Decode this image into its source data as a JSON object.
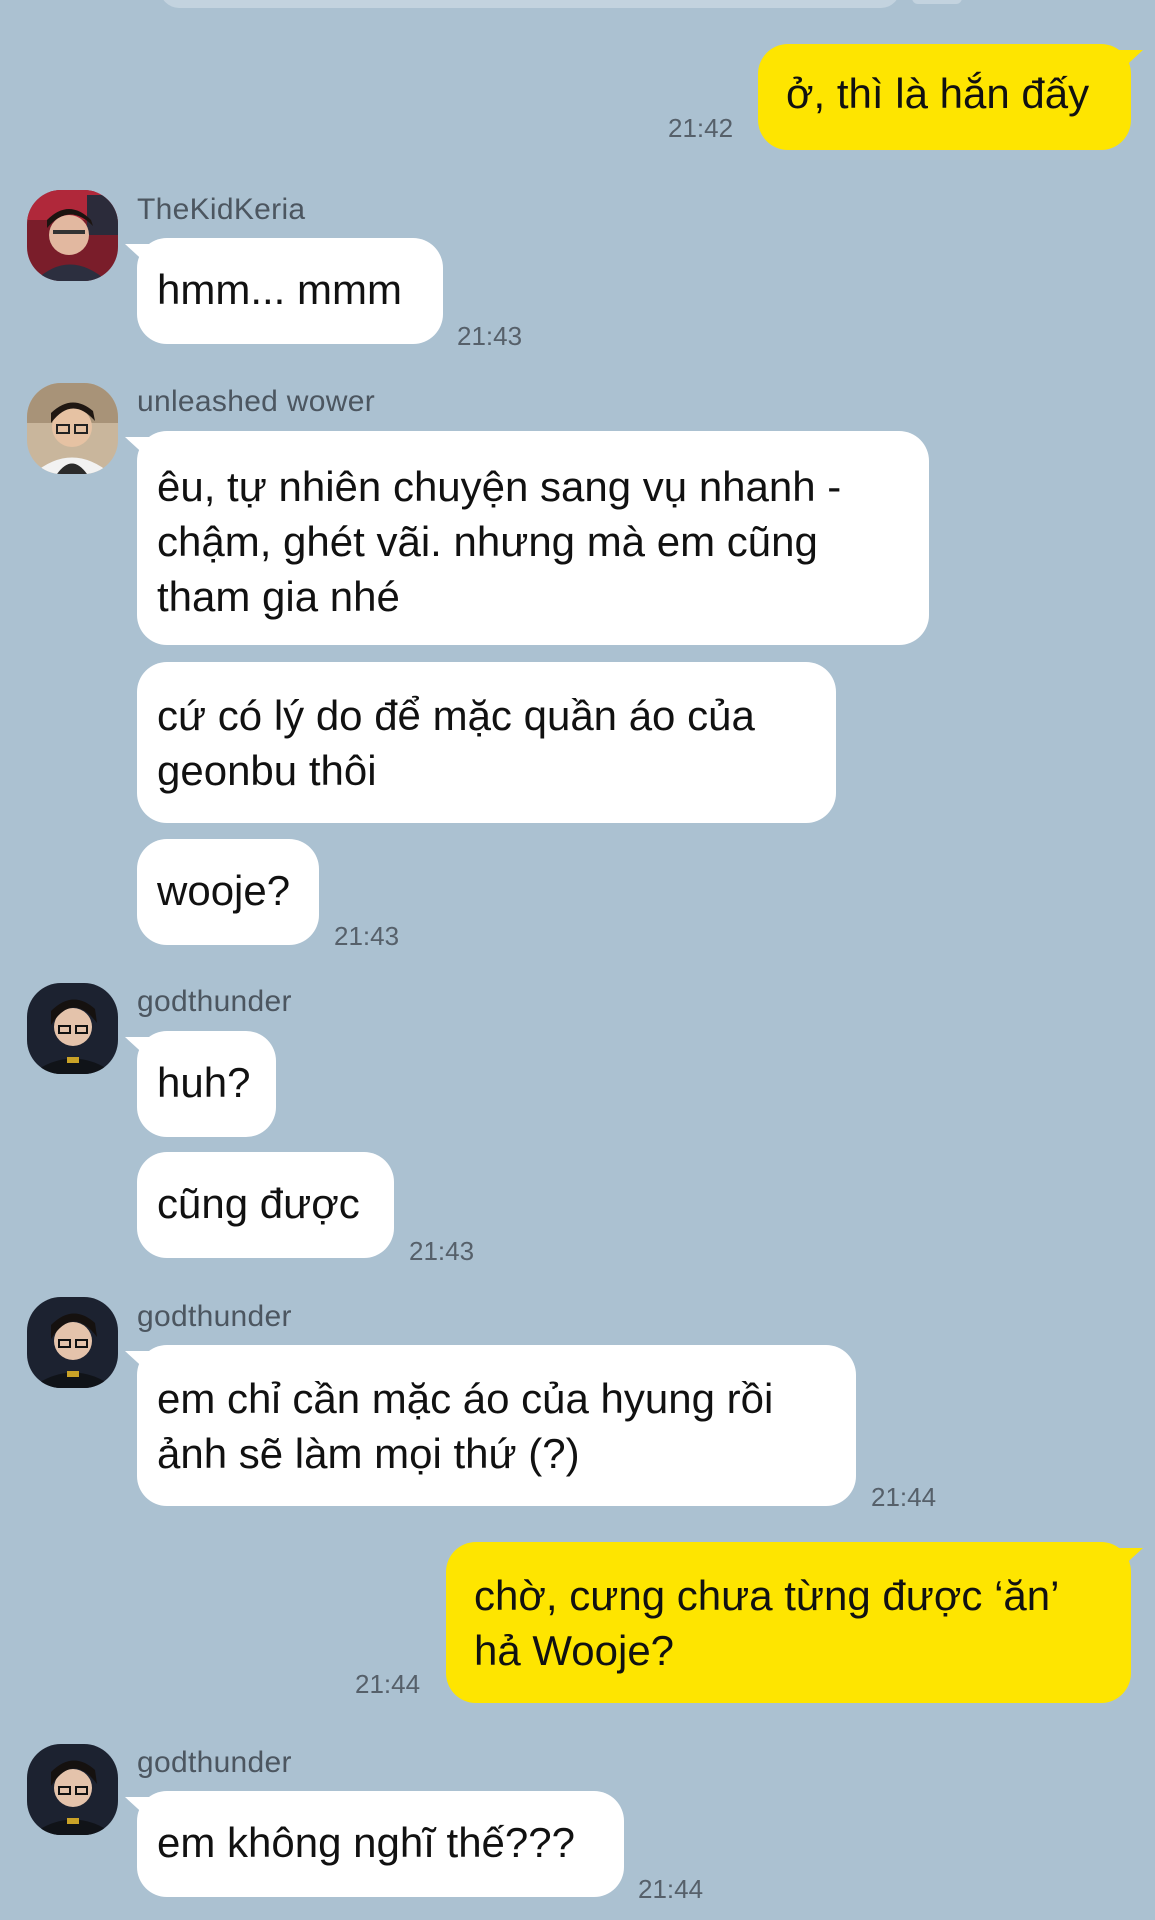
{
  "chat": {
    "messages": [
      {
        "direction": "out",
        "text": "ở, thì là hắn đấy",
        "time": "21:42"
      },
      {
        "direction": "in",
        "sender": "TheKidKeria",
        "avatar": "avatar-thekidkeria",
        "text": "hmm... mmm",
        "time": "21:43"
      },
      {
        "direction": "in",
        "sender": "unleashed wower",
        "avatar": "avatar-unleashed-wower",
        "lines": [
          "êu, tự nhiên chuyện sang vụ nhanh -",
          "chậm, ghét vãi. nhưng mà em cũng",
          "tham gia nhé"
        ]
      },
      {
        "direction": "in",
        "lines": [
          "cứ có lý do để mặc quần áo của",
          "geonbu thôi"
        ]
      },
      {
        "direction": "in",
        "text": "wooje?",
        "time": "21:43"
      },
      {
        "direction": "in",
        "sender": "godthunder",
        "avatar": "avatar-godthunder",
        "text": "huh?"
      },
      {
        "direction": "in",
        "text": "cũng được",
        "time": "21:43"
      },
      {
        "direction": "in",
        "sender": "godthunder",
        "avatar": "avatar-godthunder",
        "lines": [
          "em chỉ cần mặc áo của hyung rồi",
          "ảnh sẽ làm mọi thứ (?)"
        ],
        "time": "21:44"
      },
      {
        "direction": "out",
        "lines": [
          "chờ, cưng chưa từng được ‘ăn’",
          "hả Wooje?"
        ],
        "time": "21:44"
      },
      {
        "direction": "in",
        "sender": "godthunder",
        "avatar": "avatar-godthunder",
        "text": "em không nghĩ thế???",
        "time": "21:44"
      }
    ]
  },
  "colors": {
    "background": "#abc1d1",
    "incoming_bubble": "#ffffff",
    "outgoing_bubble": "#fee500",
    "sender_name": "#4c5660",
    "timestamp": "#56606a"
  }
}
